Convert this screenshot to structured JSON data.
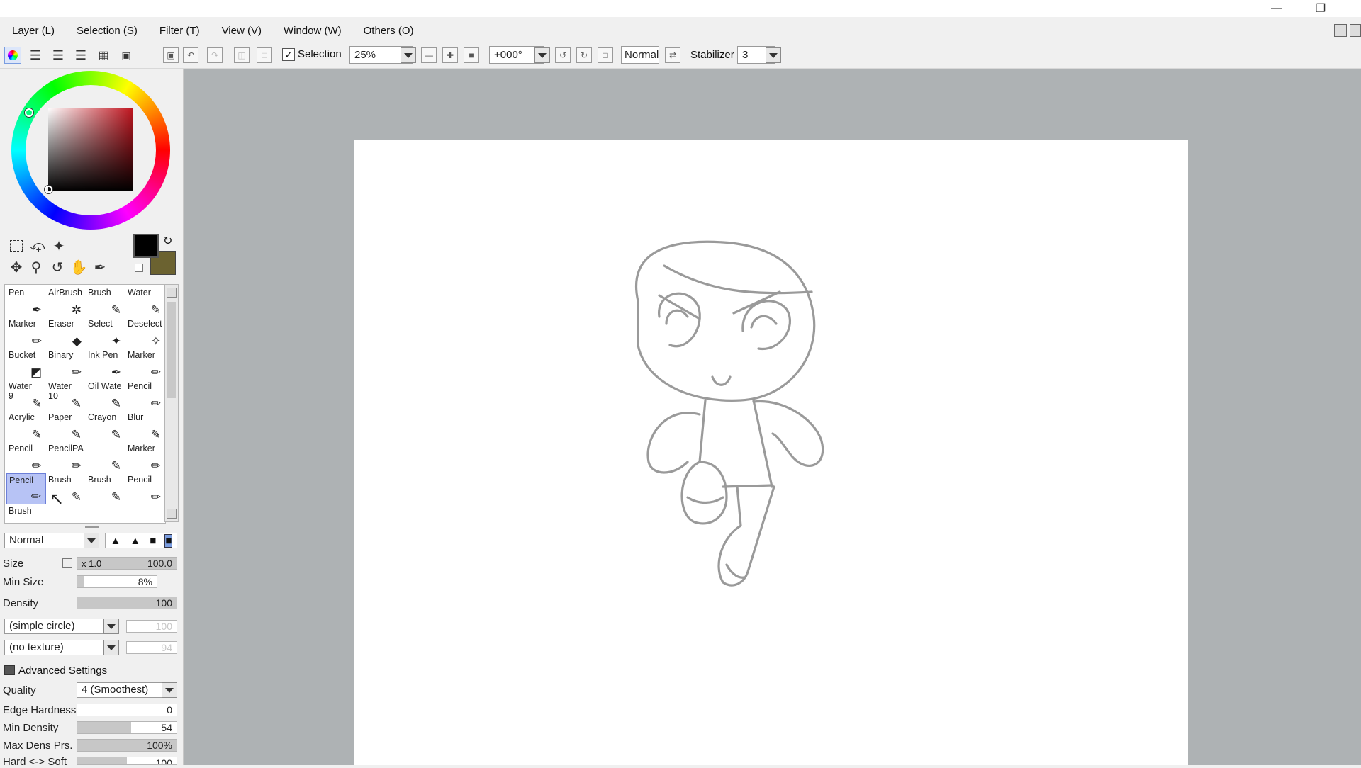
{
  "menubar": {
    "items": [
      "Layer (L)",
      "Selection (S)",
      "Filter (T)",
      "View (V)",
      "Window (W)",
      "Others (O)"
    ]
  },
  "toolbar": {
    "selection_label": "Selection",
    "zoom_value": "25%",
    "rotation_value": "+000°",
    "blend_mode": "Normal",
    "stabilizer_label": "Stabilizer",
    "stabilizer_value": "3"
  },
  "color": {
    "primary": "#000000",
    "secondary": "#6b6230",
    "hue_square_base": "#c0141e"
  },
  "brushes": [
    {
      "label": "Pen",
      "glyph": "pen-icon"
    },
    {
      "label": "AirBrush",
      "glyph": "airbrush-icon"
    },
    {
      "label": "Brush",
      "glyph": "brush-icon"
    },
    {
      "label": "Water",
      "glyph": "water-icon"
    },
    {
      "label": "Marker",
      "glyph": "marker-icon"
    },
    {
      "label": "Eraser",
      "glyph": "eraser-icon"
    },
    {
      "label": "Select",
      "glyph": "select-icon"
    },
    {
      "label": "Deselect",
      "glyph": "deselect-icon"
    },
    {
      "label": "Bucket",
      "glyph": "bucket-icon"
    },
    {
      "label": "Binary",
      "glyph": "binary-icon"
    },
    {
      "label": "Ink Pen",
      "glyph": "pen-icon"
    },
    {
      "label": "Marker",
      "glyph": "marker-icon"
    },
    {
      "label": "Water\n9",
      "glyph": "brush-icon"
    },
    {
      "label": "Water\n10",
      "glyph": "brush-icon"
    },
    {
      "label": "Oil Wate",
      "glyph": "brush-icon"
    },
    {
      "label": "Pencil",
      "glyph": "pencil-icon"
    },
    {
      "label": "Acrylic",
      "glyph": "brush-icon"
    },
    {
      "label": "Paper",
      "glyph": "brush-icon"
    },
    {
      "label": "Crayon",
      "glyph": "brush-icon"
    },
    {
      "label": "Blur",
      "glyph": "water-icon"
    },
    {
      "label": "Pencil",
      "glyph": "pencil-icon"
    },
    {
      "label": "PencilPA",
      "glyph": "pencil-icon"
    },
    {
      "label": "",
      "glyph": "brush-icon"
    },
    {
      "label": "Marker",
      "glyph": "marker-icon"
    },
    {
      "label": "Pencil",
      "glyph": "pencil-icon"
    },
    {
      "label": "Brush",
      "glyph": "brush-icon"
    },
    {
      "label": "Brush",
      "glyph": "brush-icon"
    },
    {
      "label": "Pencil",
      "glyph": "pencil-icon"
    },
    {
      "label": "Brush",
      "glyph": "brush-icon"
    }
  ],
  "selected_brush_index": 24,
  "brush_settings": {
    "blend_mode": "Normal",
    "size_label": "Size",
    "size_multiplier": "x 1.0",
    "size_value": "100.0",
    "min_size_label": "Min Size",
    "min_size_value": "8%",
    "density_label": "Density",
    "density_value": "100",
    "shape": "(simple circle)",
    "shape_value": "100",
    "texture": "(no texture)",
    "texture_value": "94",
    "advanced_label": "Advanced Settings",
    "quality_label": "Quality",
    "quality_value": "4 (Smoothest)",
    "edge_hardness_label": "Edge Hardness",
    "edge_hardness_value": "0",
    "min_density_label": "Min Density",
    "min_density_value": "54",
    "max_dens_prs_label": "Max Dens Prs.",
    "max_dens_prs_value": "100%",
    "hard_soft_label": "Hard <-> Soft",
    "hard_soft_value": "100"
  }
}
